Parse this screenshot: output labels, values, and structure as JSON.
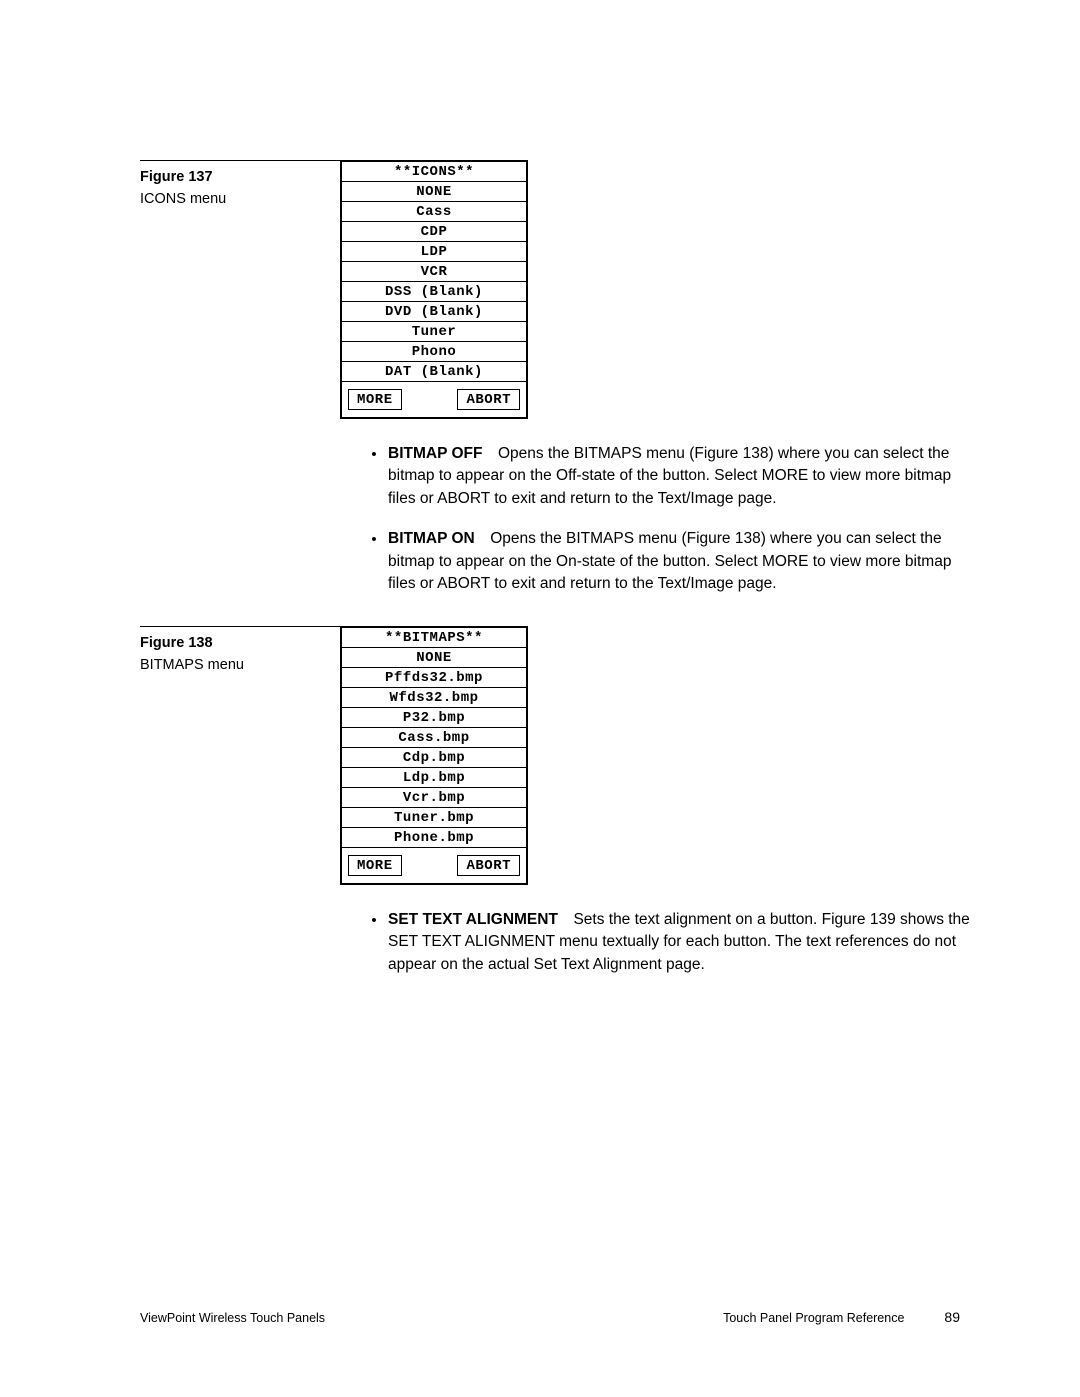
{
  "figure137": {
    "label": "Figure 137",
    "desc": "ICONS menu",
    "menu": {
      "header": "**ICONS**",
      "rows": [
        "NONE",
        "Cass",
        "CDP",
        "LDP",
        "VCR",
        "DSS (Blank)",
        "DVD (Blank)",
        "Tuner",
        "Phono",
        "DAT (Blank)"
      ],
      "more": "MORE",
      "abort": "ABORT"
    }
  },
  "bullets1": [
    {
      "term": "BITMAP OFF",
      "sep": " ",
      "text": "Opens the BITMAPS menu (Figure 138) where you can select the bitmap to appear on the Off-state of the button. Select MORE to view more bitmap files or ABORT to exit and return to the Text/Image page."
    },
    {
      "term": "BITMAP ON",
      "sep": " ",
      "text": "Opens the BITMAPS menu (Figure 138) where you can select the bitmap to appear on the On-state of the button. Select MORE to view more bitmap files or ABORT to exit and return to the Text/Image page."
    }
  ],
  "figure138": {
    "label": "Figure 138",
    "desc": "BITMAPS menu",
    "menu": {
      "header": "**BITMAPS**",
      "rows": [
        "NONE",
        "Pffds32.bmp",
        "Wfds32.bmp",
        "P32.bmp",
        "Cass.bmp",
        "Cdp.bmp",
        "Ldp.bmp",
        "Vcr.bmp",
        "Tuner.bmp",
        "Phone.bmp"
      ],
      "more": "MORE",
      "abort": "ABORT"
    }
  },
  "bullets2": [
    {
      "term": "SET TEXT ALIGNMENT",
      "sep": " ",
      "text": "Sets the text alignment on a button. Figure 139 shows the SET TEXT ALIGNMENT menu textually for each button. The text references do not appear on the actual Set Text Alignment page."
    }
  ],
  "footer": {
    "left": "ViewPoint Wireless Touch Panels",
    "rightText": "Touch Panel Program Reference",
    "pageNum": "89"
  }
}
